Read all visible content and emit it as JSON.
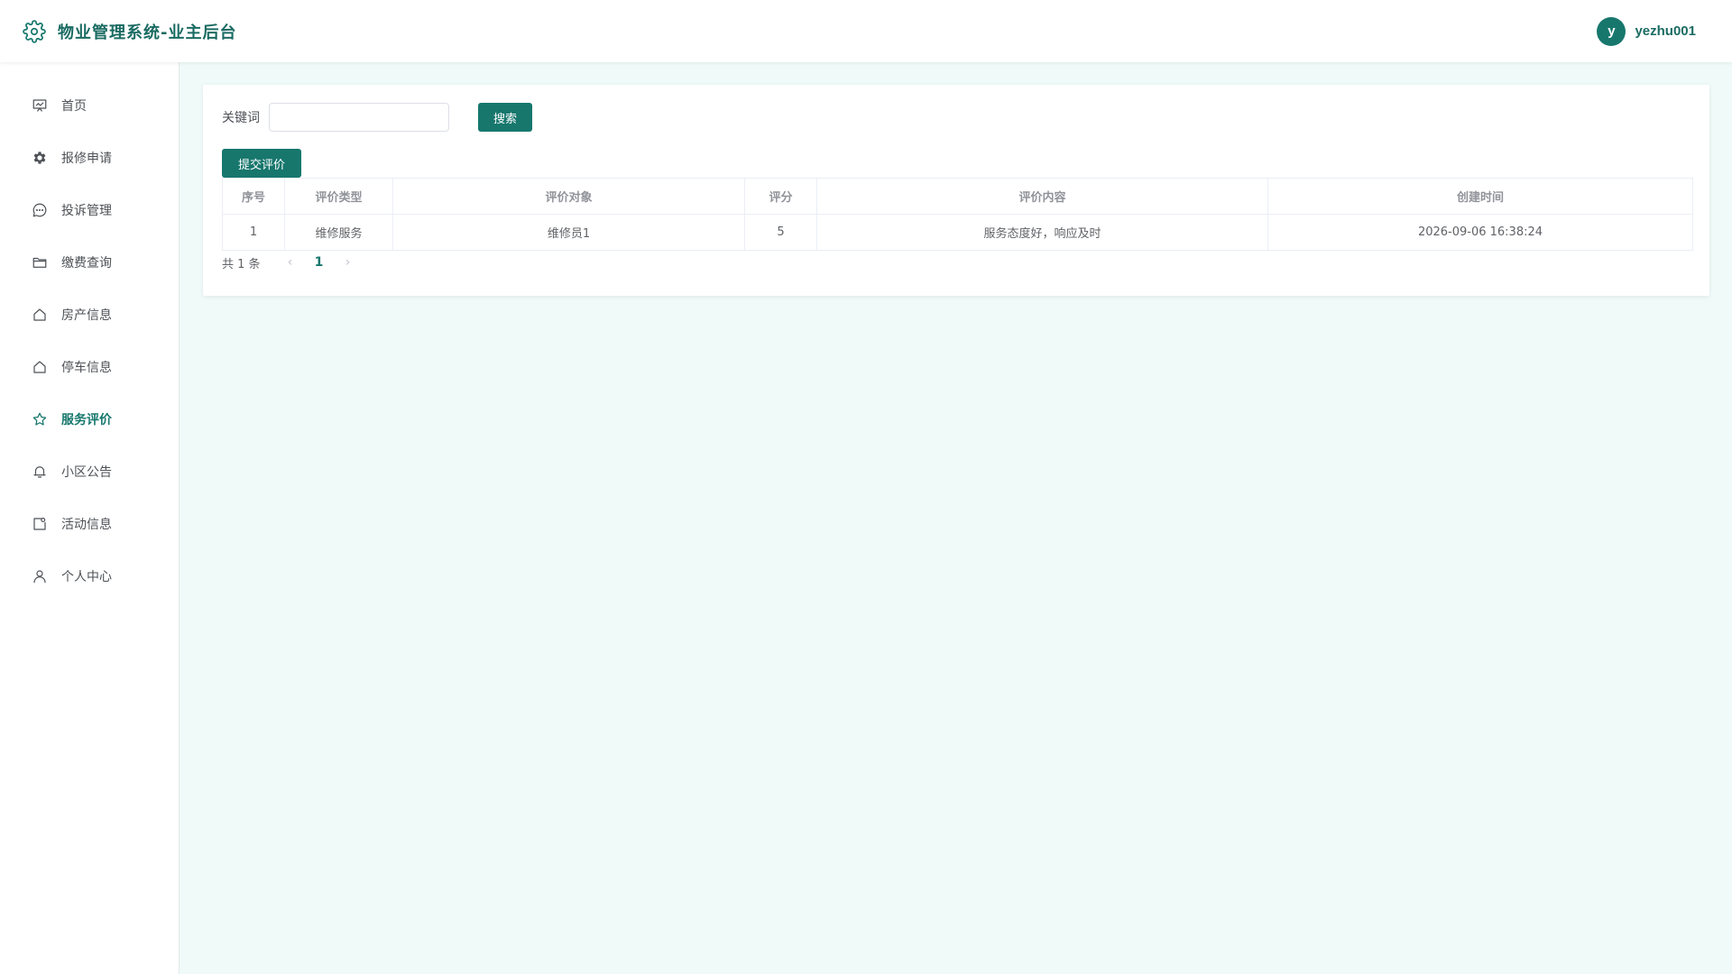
{
  "header": {
    "title": "物业管理系统-业主后台",
    "logo_icon": "gear-icon",
    "avatar_letter": "y",
    "username": "yezhu001"
  },
  "colors": {
    "accent": "#17776d",
    "title": "#1a6b62",
    "background": "#f0fbf9"
  },
  "sidebar": {
    "items": [
      {
        "label": "首页",
        "icon": "presentation-board-icon",
        "active": false
      },
      {
        "label": "报修申请",
        "icon": "gear-icon",
        "active": false
      },
      {
        "label": "投诉管理",
        "icon": "chat-bubble-icon",
        "active": false
      },
      {
        "label": "缴费查询",
        "icon": "folder-icon",
        "active": false
      },
      {
        "label": "房产信息",
        "icon": "house-icon",
        "active": false
      },
      {
        "label": "停车信息",
        "icon": "house-icon",
        "active": false
      },
      {
        "label": "服务评价",
        "icon": "star-icon",
        "active": true
      },
      {
        "label": "小区公告",
        "icon": "bell-icon",
        "active": false
      },
      {
        "label": "活动信息",
        "icon": "calendar-card-icon",
        "active": false
      },
      {
        "label": "个人中心",
        "icon": "user-icon",
        "active": false
      }
    ]
  },
  "search": {
    "label": "关键词",
    "value": "",
    "placeholder": "",
    "button_label": "搜索"
  },
  "toolbar": {
    "add_label": "提交评价"
  },
  "table": {
    "columns": [
      "序号",
      "评价类型",
      "评价对象",
      "评分",
      "评价内容",
      "创建时间"
    ],
    "rows": [
      [
        "1",
        "维修服务",
        "维修员1",
        "5",
        "服务态度好，响应及时",
        "2026-09-06 16:38:24"
      ]
    ]
  },
  "pagination": {
    "total_text": "共 1 条",
    "prev": "‹",
    "current_page": "1",
    "next": "›"
  }
}
